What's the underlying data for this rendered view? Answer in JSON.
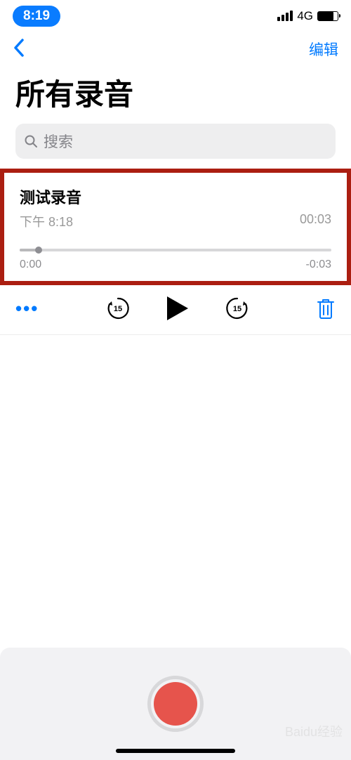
{
  "status": {
    "time": "8:19",
    "network": "4G"
  },
  "nav": {
    "edit": "编辑"
  },
  "title": "所有录音",
  "search": {
    "placeholder": "搜索"
  },
  "recording": {
    "title": "测试录音",
    "timestamp": "下午 8:18",
    "duration": "00:03",
    "elapsed": "0:00",
    "remaining": "-0:03",
    "skip_seconds": "15"
  },
  "watermark": "Baidu经验"
}
